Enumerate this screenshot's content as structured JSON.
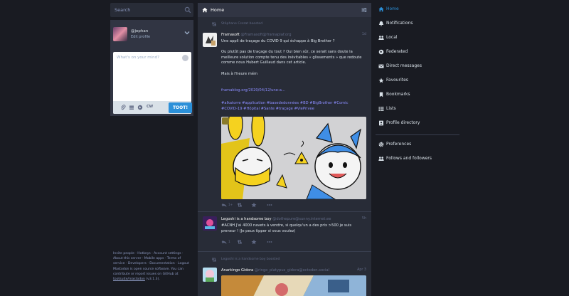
{
  "search": {
    "placeholder": "Search"
  },
  "compose": {
    "username": "@jephan",
    "edit_profile": "Edit profile",
    "placeholder": "What's on your mind?",
    "cw_label": "CW",
    "char_count": "500",
    "toot_label": "TOOT!"
  },
  "footer": {
    "line1": "Invite people · Hotkeys · Account settings · About this server · Mobile apps · Terms of service · Developers · Documentation · Logout",
    "line2_prefix": "Mastodon is open source software. You can contribute or report issues on GitHub at",
    "line2_link": "tootsuite/mastodon",
    "line2_suffix": "(v3.1.3)."
  },
  "column": {
    "title": "Home"
  },
  "statuses": [
    {
      "boosted_by": "Stéphane Crozat boosted",
      "display_name": "Framasoft",
      "account": "@Framasoft@framapiaf.org",
      "time": "1d",
      "body": "Une appli de traçage du COVID 9 qui échappe à Big Brother ?\n\nOu plutôt pas de traçage du tout ? Oui bien sûr, ce serait sans doute la meilleure solution compte tenu des inévitables « glissements » que redoute comme nous Hubert Guillaud dans cet article.\n\nMais à l'heure mém",
      "link": "framablog.org/2020/04/12/une-a...",
      "hashtags": "#alkatorre #application #basededonnées #BD #BigBrother #Comic #COVID-19 #Hôpital #Sante #traçage #ViePrivee",
      "reply_count": "1+",
      "colors": {
        "bg": "#d2d2d4",
        "yellow": "#f5d21f",
        "blue": "#3f8ee6"
      }
    },
    {
      "display_name": "Legoshi is a handsome boy",
      "account": "@dothepure@sunny.internet.ee",
      "time": "5h",
      "body": "#ACNH J'ai 4000 navets à vendre, si quelqu'un a des prix >500 je suis preneur ! (Je peux tipper si vous voulez)",
      "reply_count": "1"
    },
    {
      "boosted_by": "Legoshi is a handsome boy boosted",
      "display_name": "Anarkingo Gidora",
      "account": "@ringo_platypus_gidora@octodon.social",
      "time": "Apr 3"
    }
  ],
  "nav": [
    {
      "label": "Home",
      "icon": "home-icon",
      "active": true
    },
    {
      "label": "Notifications",
      "icon": "bell-icon"
    },
    {
      "label": "Local",
      "icon": "users-icon"
    },
    {
      "label": "Federated",
      "icon": "globe-icon"
    },
    {
      "label": "Direct messages",
      "icon": "envelope-icon"
    },
    {
      "label": "Favourites",
      "icon": "star-icon"
    },
    {
      "label": "Bookmarks",
      "icon": "bookmark-icon"
    },
    {
      "label": "Lists",
      "icon": "list-icon"
    },
    {
      "label": "Profile directory",
      "icon": "address-book-icon"
    },
    {
      "label": "Preferences",
      "icon": "gear-icon"
    },
    {
      "label": "Follows and followers",
      "icon": "users-icon"
    }
  ],
  "colors": {
    "accent": "#2b90d9",
    "background": "#191b22",
    "column": "#282c37",
    "panel": "#313543"
  }
}
